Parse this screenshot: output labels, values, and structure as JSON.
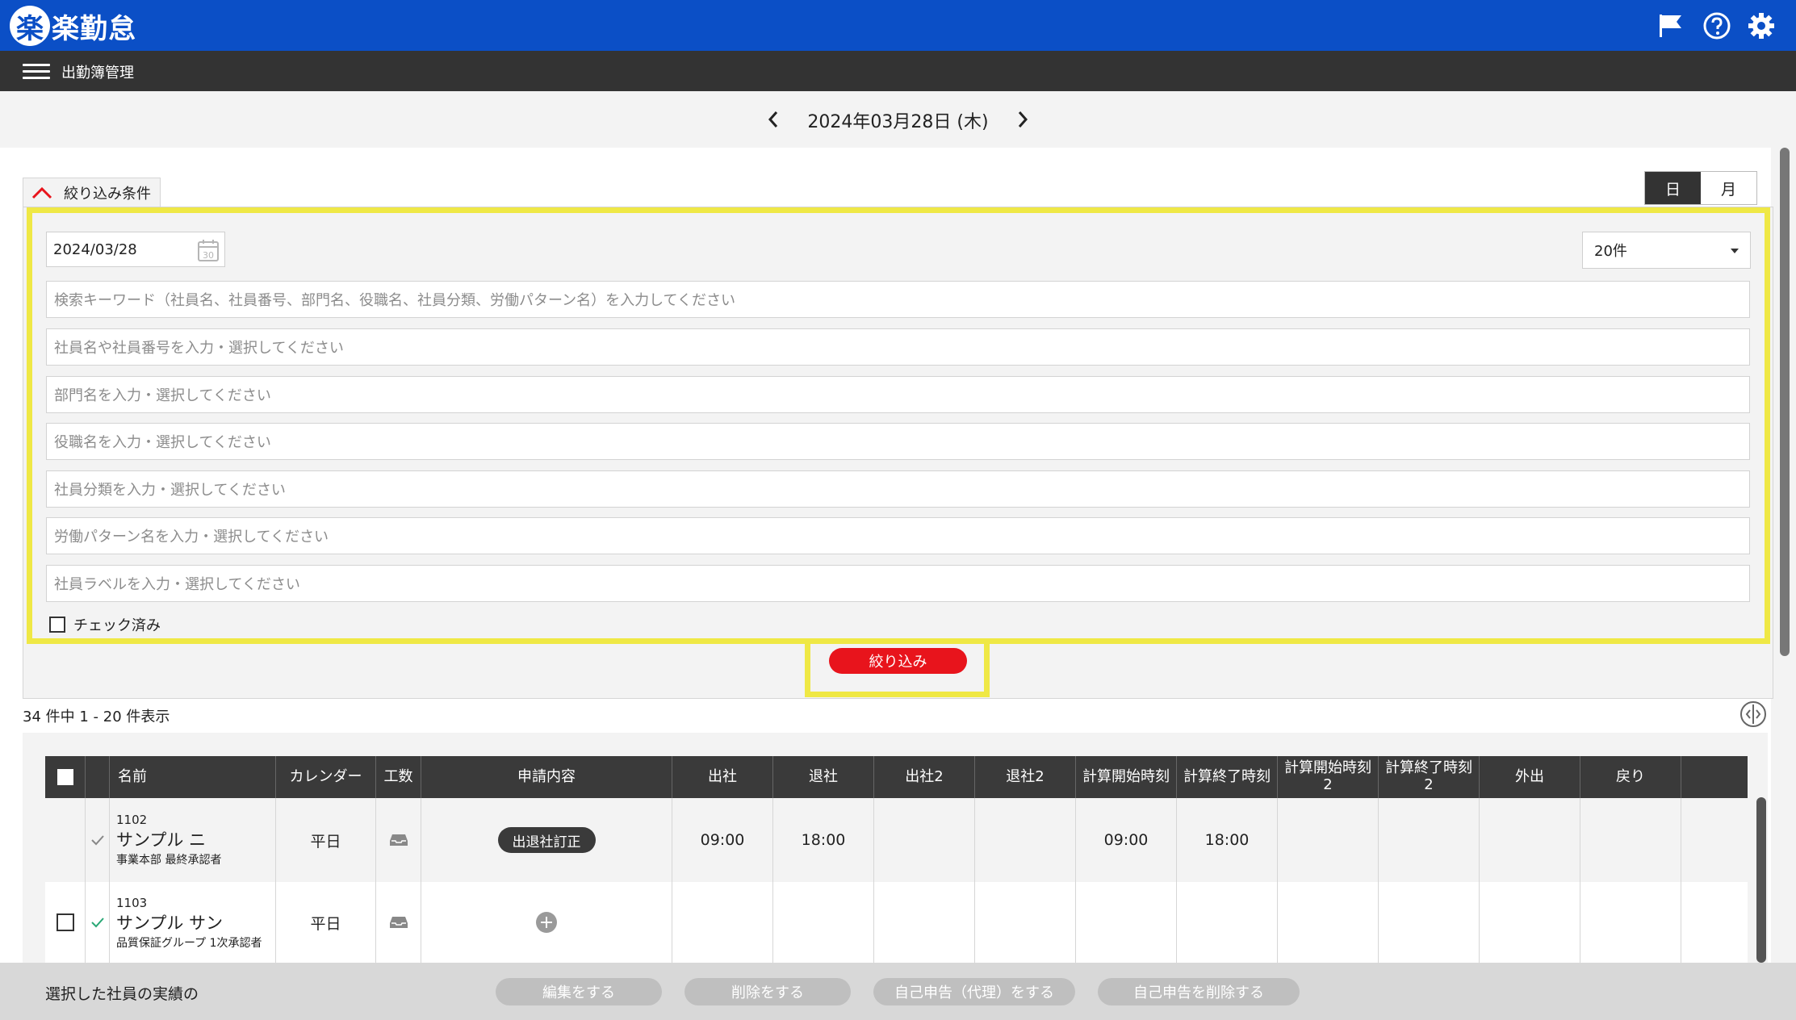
{
  "app": {
    "logo_mark": "楽",
    "logo_text": "楽勤怠"
  },
  "header_icons": [
    "flag-icon",
    "help-icon",
    "gear-icon"
  ],
  "subbar": {
    "title": "出勤簿管理"
  },
  "date_nav": {
    "current_date": "2024年03月28日 (木)"
  },
  "filter": {
    "tab_label": "絞り込み条件",
    "date_value": "2024/03/28",
    "calendar_day": "30",
    "count_select": "20件",
    "keyword_placeholder": "検索キーワード（社員名、社員番号、部門名、役職名、社員分類、労働パターン名）を入力してください",
    "employee_placeholder": "社員名や社員番号を入力・選択してください",
    "department_placeholder": "部門名を入力・選択してください",
    "position_placeholder": "役職名を入力・選択してください",
    "category_placeholder": "社員分類を入力・選択してください",
    "pattern_placeholder": "労働パターン名を入力・選択してください",
    "label_placeholder": "社員ラベルを入力・選択してください",
    "checked_label": "チェック済み",
    "submit_label": "絞り込み"
  },
  "view_toggle": {
    "day": "日",
    "month": "月"
  },
  "results": {
    "count_text": "34 件中 1 - 20 件表示"
  },
  "table": {
    "headers": {
      "name": "名前",
      "calendar": "カレンダー",
      "work": "工数",
      "request": "申請内容",
      "clock_in": "出社",
      "clock_out": "退社",
      "clock_in2": "出社2",
      "clock_out2": "退社2",
      "calc_start": "計算開始時刻",
      "calc_end": "計算終了時刻",
      "calc_start2": "計算開始時刻\n2",
      "calc_end2": "計算終了時刻\n2",
      "out": "外出",
      "back": "戻り"
    },
    "rows": [
      {
        "emp_no": "1102",
        "name": "サンプル ニ",
        "dept": "事業本部 最終承認者",
        "calendar": "平日",
        "request": "出退社訂正",
        "clock_in": "09:00",
        "clock_out": "18:00",
        "calc_start": "09:00",
        "calc_end": "18:00"
      },
      {
        "emp_no": "1103",
        "name": "サンプル サン",
        "dept": "品質保証グループ 1次承認者",
        "calendar": "平日"
      }
    ]
  },
  "bottom": {
    "label": "選択した社員の実績の",
    "edit": "編集をする",
    "delete": "削除をする",
    "self_report_proxy": "自己申告（代理）をする",
    "self_report_delete": "自己申告を削除する"
  },
  "colors": {
    "topbar": "#0b4fc6",
    "subbar": "#333333",
    "highlight": "#efe845",
    "submit": "#e8141c"
  }
}
